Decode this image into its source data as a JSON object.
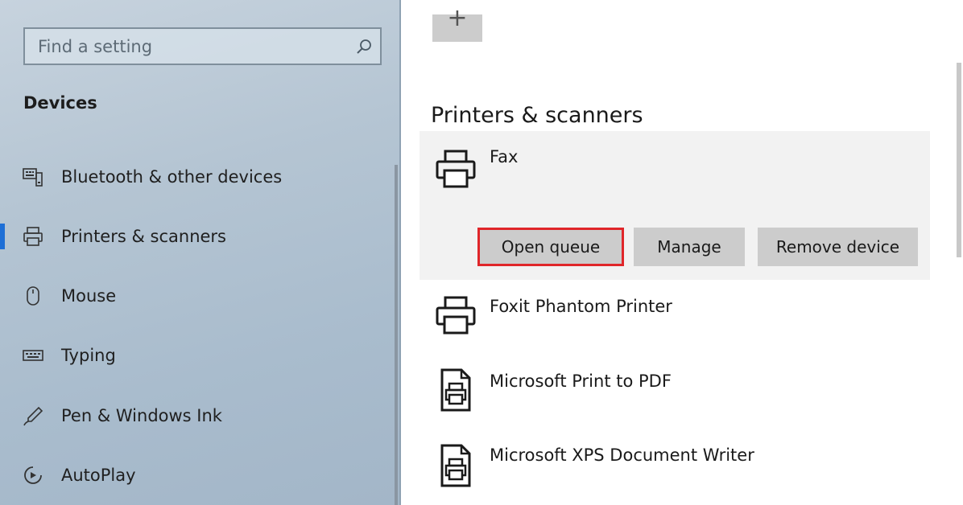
{
  "search": {
    "placeholder": "Find a setting"
  },
  "sidebar": {
    "section_title": "Devices",
    "items": [
      {
        "label": "Bluetooth & other devices",
        "icon": "bluetooth-devices-icon",
        "active": false
      },
      {
        "label": "Printers & scanners",
        "icon": "printer-icon",
        "active": true
      },
      {
        "label": "Mouse",
        "icon": "mouse-icon",
        "active": false
      },
      {
        "label": "Typing",
        "icon": "keyboard-icon",
        "active": false
      },
      {
        "label": "Pen & Windows Ink",
        "icon": "pen-icon",
        "active": false
      },
      {
        "label": "AutoPlay",
        "icon": "autoplay-icon",
        "active": false
      }
    ]
  },
  "main": {
    "add_label": "+",
    "heading": "Printers & scanners",
    "devices": [
      {
        "name": "Fax",
        "icon": "printer-icon",
        "selected": true
      },
      {
        "name": "Foxit Phantom Printer",
        "icon": "printer-icon",
        "selected": false
      },
      {
        "name": "Microsoft Print to PDF",
        "icon": "document-printer-icon",
        "selected": false
      },
      {
        "name": "Microsoft XPS Document Writer",
        "icon": "document-printer-icon",
        "selected": false
      }
    ],
    "actions": {
      "open_queue": "Open queue",
      "manage": "Manage",
      "remove_device": "Remove device"
    }
  },
  "colors": {
    "accent": "#1e6fd6",
    "highlight_border": "#e0262a",
    "button_bg": "#cccccc",
    "selected_bg": "#f2f2f2"
  }
}
